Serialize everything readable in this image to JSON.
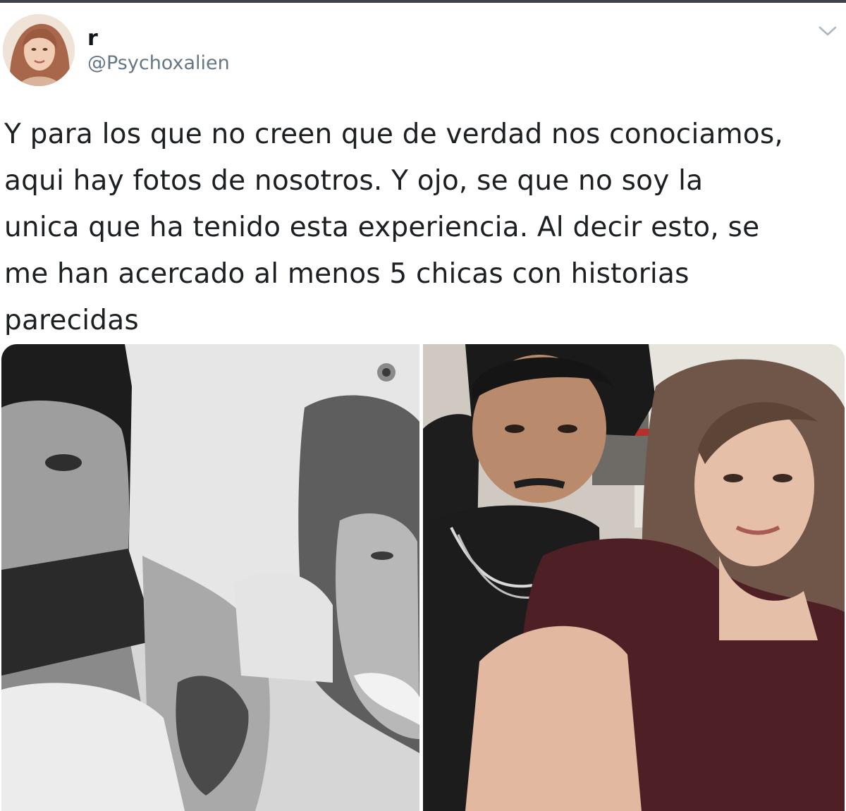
{
  "tweet": {
    "display_name": "r",
    "handle": "@Psychoxalien",
    "text": "Y para los que no creen que de verdad nos conociamos,\naqui hay fotos de nosotros. Y ojo, se que no soy la\nunica que ha tenido esta experiencia. Al decir esto, se\nme han acercado al menos 5 chicas con historias\nparecidas"
  },
  "icons": {
    "avatar": "profile-photo",
    "menu": "chevron-down-icon"
  },
  "media": {
    "count": 2,
    "photos": [
      {
        "style": "black-and-white selfie"
      },
      {
        "style": "color selfie"
      }
    ]
  },
  "colors": {
    "text": "#1c2022",
    "handle": "#657786",
    "caret": "#aab8c2",
    "top_bar": "#3d4049"
  }
}
